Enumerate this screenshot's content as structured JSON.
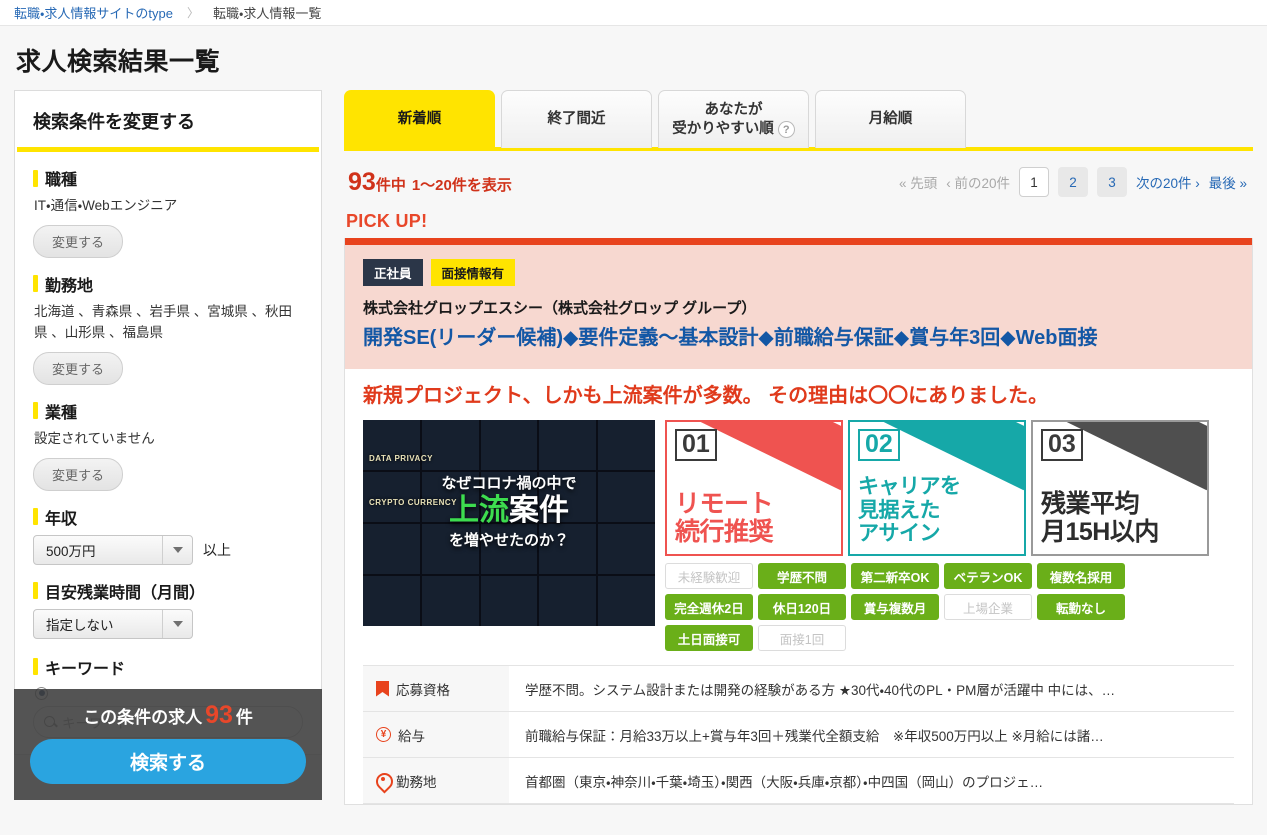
{
  "breadcrumb": {
    "home": "転職・求人情報サイトのtype",
    "separator": "〉",
    "current": "転職・求人情報一覧"
  },
  "page_title": "求人検索結果一覧",
  "sidebar": {
    "heading": "検索条件を変更する",
    "change_label": "変更する",
    "sections": [
      {
        "label": "職種",
        "value": "IT・通信・Webエンジニア"
      },
      {
        "label": "勤務地",
        "value": "北海道 、青森県 、岩手県 、宮城県 、秋田県 、山形県 、福島県"
      },
      {
        "label": "業種",
        "value": "設定されていません"
      }
    ],
    "income": {
      "label": "年収",
      "selected": "500万円",
      "suffix": "以上"
    },
    "overtime": {
      "label": "目安残業時間（月間）",
      "selected": "指定しない"
    },
    "keyword": {
      "label": "キーワード",
      "placeholder": "キーワード"
    },
    "overlay": {
      "prefix": "この条件の求人",
      "count": "93",
      "unit": "件",
      "button": "検索する"
    }
  },
  "tabs": [
    {
      "label": "新着順",
      "active": true
    },
    {
      "label": "終了間近",
      "active": false
    },
    {
      "label": "あなたが",
      "label2": "受かりやすい順",
      "help": "?",
      "active": false
    },
    {
      "label": "月給順",
      "active": false
    }
  ],
  "results": {
    "total": "93",
    "total_unit": "件中",
    "range": "1～20件を表示"
  },
  "pagination": {
    "first": "« 先頭",
    "prev": "‹ 前の20件",
    "pages": [
      "1",
      "2",
      "3"
    ],
    "current_page": "1",
    "next": "次の20件 ›",
    "last": "最後 »"
  },
  "pickup_label": "PICK UP!",
  "job": {
    "badges": [
      "正社員",
      "面接情報有"
    ],
    "company": "株式会社グロップエスシー（株式会社グロップ グループ）",
    "title": "開発SE(リーダー候補)◆要件定義～基本設計◆前職給与保証◆賞与年3回◆Web面接",
    "catch": "新規プロジェクト、しかも上流案件が多数。 その理由は〇〇にありました。",
    "collage": {
      "line1": "なぜコロナ禍の中で",
      "line2_green": "上流",
      "line2_white": "案件",
      "line3": "を増やせたのか？",
      "mini_texts": [
        "DATA PRIVACY",
        "CRYPTO CURRENCY"
      ]
    },
    "promos": [
      {
        "num": "01",
        "line1": "リモート",
        "line2": "続行推奨",
        "color": "#ef5350"
      },
      {
        "num": "02",
        "line1": "キャリアを",
        "line2": "見据えた",
        "line3": "アサイン",
        "color": "#16a8a8"
      },
      {
        "num": "03",
        "line1": "残業平均",
        "line2": "月15H以内",
        "color": "#4f4f4f"
      }
    ],
    "tags": [
      {
        "label": "未経験歓迎",
        "on": false
      },
      {
        "label": "学歴不問",
        "on": true
      },
      {
        "label": "第二新卒OK",
        "on": true
      },
      {
        "label": "ベテランOK",
        "on": true
      },
      {
        "label": "複数名採用",
        "on": true
      },
      {
        "label": "完全週休2日",
        "on": true
      },
      {
        "label": "休日120日",
        "on": true
      },
      {
        "label": "賞与複数月",
        "on": true
      },
      {
        "label": "上場企業",
        "on": false
      },
      {
        "label": "転勤なし",
        "on": true
      },
      {
        "label": "土日面接可",
        "on": true
      },
      {
        "label": "面接1回",
        "on": false
      }
    ],
    "details": [
      {
        "icon": "bookmark-icon",
        "label": "応募資格",
        "value": "学歴不問。システム設計または開発の経験がある方 ★30代・40代のPL・PM層が活躍中 中には、…"
      },
      {
        "icon": "yen-icon",
        "label": "給与",
        "value": "前職給与保証：月給33万以上+賞与年3回＋残業代全額支給　※年収500万円以上 ※月給には諸…"
      },
      {
        "icon": "pin-icon",
        "label": "勤務地",
        "value": "首都圏（東京・神奈川・千葉・埼玉）・関西（大阪・兵庫・京都）・中四国（岡山）のプロジェ…"
      }
    ]
  }
}
